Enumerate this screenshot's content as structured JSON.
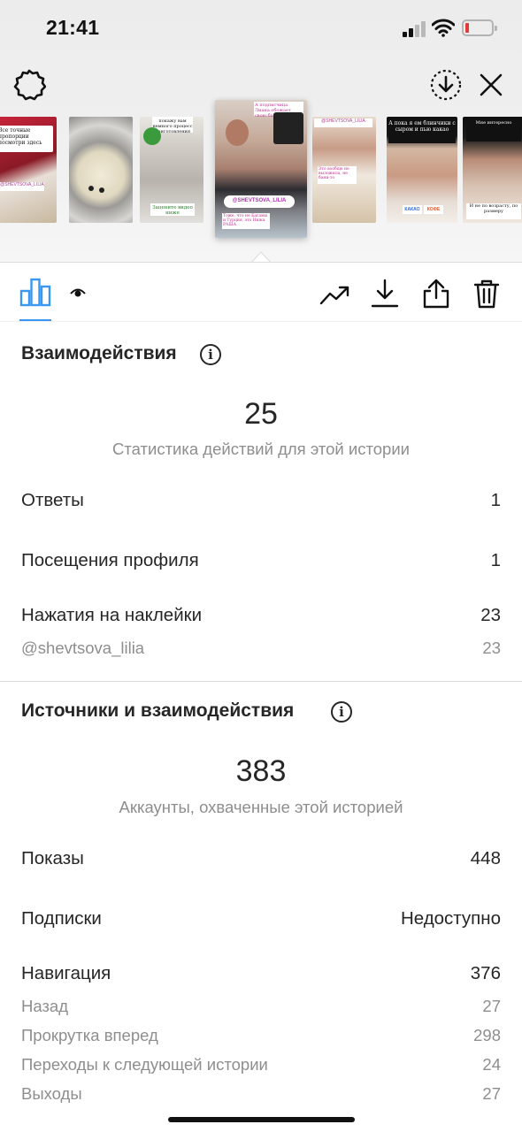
{
  "status_bar": {
    "time": "21:41"
  },
  "story_strip": {
    "thumbnails": [
      {
        "text": "Все точные пропорции посмотри здесь",
        "tag": "@SHEVTSOVA_LILIA"
      },
      {
        "text": ""
      },
      {
        "text": "Зацените видео ниже",
        "top_text": "покажу вам немного процесс приготовления"
      },
      {
        "text": "@SHEVTSOVA_LILIA",
        "top_text": "А подписчица Лиана обожает свою баню",
        "bottom_text": "Тоже, что не Багамы и Турция, это Нижа РАША"
      },
      {
        "text": "Это вообще не выложила, не бани-то",
        "tag": "@SHEVTSOVA_LILIA"
      },
      {
        "text": "А пока я ем блинчики с сыром и пью какао",
        "tags": [
          "КАКАО",
          "КОФЕ"
        ]
      },
      {
        "text": "Мне интересно",
        "bottom_text": "И не по возрасту, по размеру"
      }
    ]
  },
  "interactions": {
    "title": "Взаимодействия",
    "total": "25",
    "caption": "Статистика действий для этой истории",
    "rows": [
      {
        "label": "Ответы",
        "value": "1"
      },
      {
        "label": "Посещения профиля",
        "value": "1"
      },
      {
        "label": "Нажатия на наклейки",
        "value": "23"
      }
    ],
    "sub_rows": [
      {
        "label": "@shevtsova_lilia",
        "value": "23"
      }
    ]
  },
  "discovery": {
    "title": "Источники и взаимодействия",
    "total": "383",
    "caption": "Аккаунты, охваченные этой историей",
    "rows": [
      {
        "label": "Показы",
        "value": "448"
      },
      {
        "label": "Подписки",
        "value": "Недоступно"
      },
      {
        "label": "Навигация",
        "value": "376"
      }
    ],
    "sub_rows": [
      {
        "label": "Назад",
        "value": "27"
      },
      {
        "label": "Прокрутка вперед",
        "value": "298"
      },
      {
        "label": "Переходы к следующей истории",
        "value": "24"
      },
      {
        "label": "Выходы",
        "value": "27"
      }
    ]
  },
  "toolbar": {
    "icons": [
      "bar-chart-icon",
      "eye-icon",
      "trending-up-icon",
      "download-icon",
      "share-icon",
      "trash-icon"
    ]
  },
  "colors": {
    "accent": "#3897f0",
    "text": "#262626",
    "secondary": "#8e8e8e",
    "battery_low": "#e03a3a"
  }
}
